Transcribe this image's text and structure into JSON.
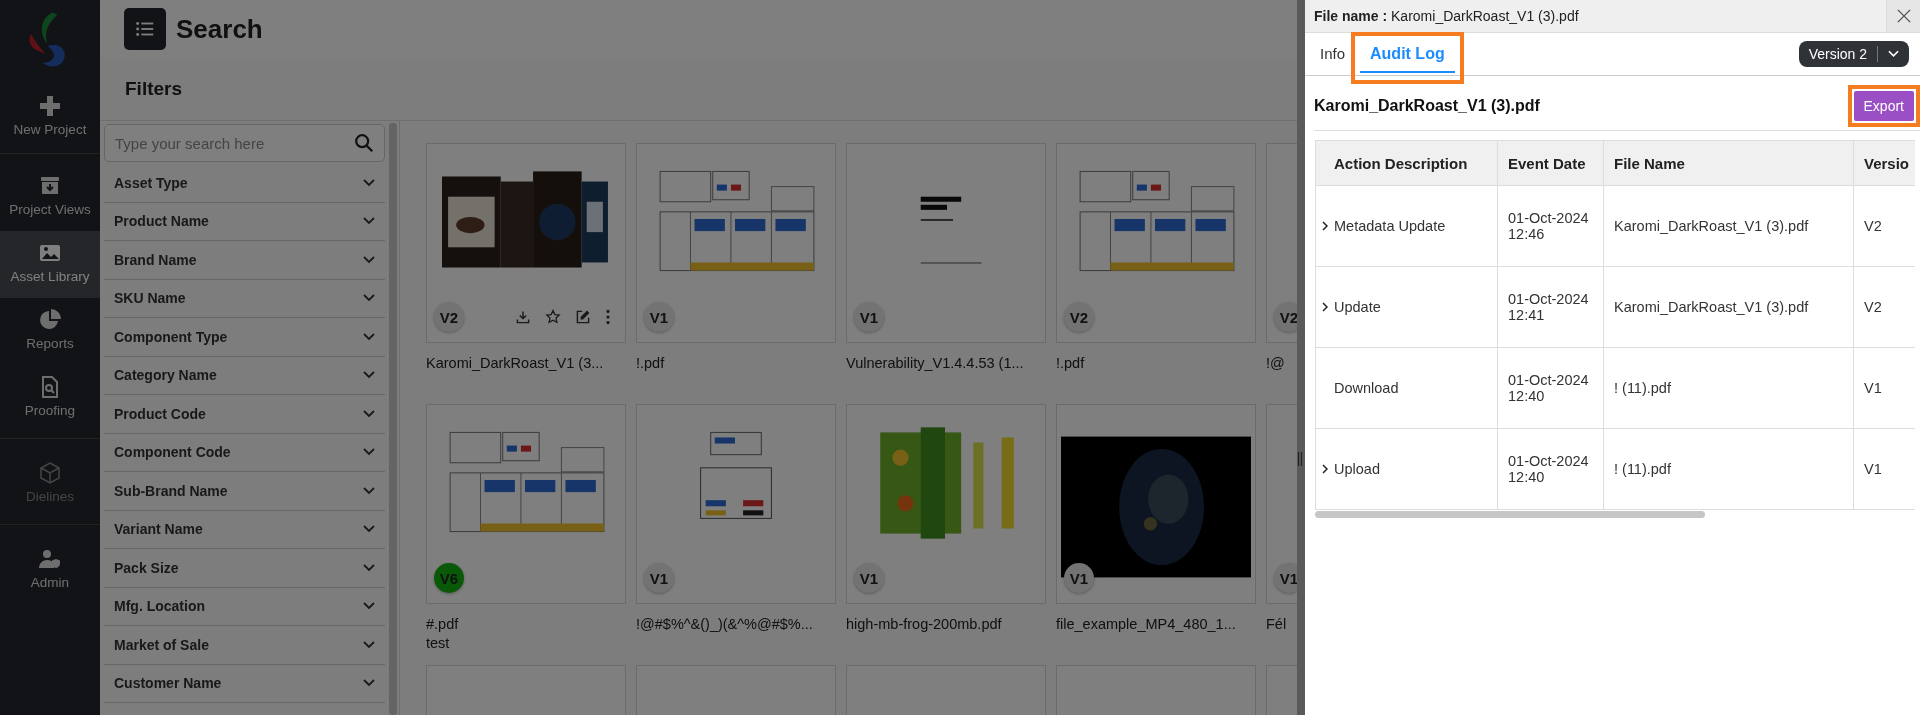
{
  "sidebar": {
    "items": [
      {
        "label": "New Project",
        "selected": false,
        "disabled": false
      },
      {
        "label": "Project Views",
        "selected": false,
        "disabled": false
      },
      {
        "label": "Asset Library",
        "selected": true,
        "disabled": false
      },
      {
        "label": "Reports",
        "selected": false,
        "disabled": false
      },
      {
        "label": "Proofing",
        "selected": false,
        "disabled": false
      },
      {
        "label": "Dielines",
        "selected": false,
        "disabled": true
      },
      {
        "label": "Admin",
        "selected": false,
        "disabled": false
      }
    ]
  },
  "header": {
    "title": "Search"
  },
  "filters": {
    "title": "Filters",
    "search": {
      "placeholder": "Type your search here"
    },
    "items": [
      "Asset Type",
      "Product Name",
      "Brand Name",
      "SKU Name",
      "Component Type",
      "Category Name",
      "Product Code",
      "Component Code",
      "Sub-Brand Name",
      "Variant Name",
      "Pack Size",
      "Mfg. Location",
      "Market of Sale",
      "Customer Name"
    ]
  },
  "assets": [
    {
      "kind": "file",
      "version": "V2",
      "highlighted": false,
      "name": "Karomi_DarkRoast_V1 (3...",
      "hovered": true
    },
    {
      "kind": "file",
      "version": "V1",
      "highlighted": false,
      "name": "!.pdf",
      "hovered": false
    },
    {
      "kind": "file",
      "version": "V1",
      "highlighted": false,
      "name": "Vulnerability_V1.4.4.53 (1...",
      "hovered": false
    },
    {
      "kind": "file",
      "version": "V2",
      "highlighted": false,
      "name": "!.pdf",
      "hovered": false
    },
    {
      "kind": "file",
      "version": "V2",
      "highlighted": false,
      "name": "!@"
    },
    {
      "kind": "file",
      "version": "V6",
      "highlighted": true,
      "name": "#.pdf",
      "note": "test",
      "hovered": false
    },
    {
      "kind": "file",
      "version": "V1",
      "highlighted": false,
      "name": "!@#$%^&()_)(&^%@#$%...",
      "hovered": false
    },
    {
      "kind": "file",
      "version": "V1",
      "highlighted": false,
      "name": "high-mb-frog-200mb.pdf",
      "hovered": false
    },
    {
      "kind": "file",
      "version": "V1",
      "highlighted": false,
      "name": "file_example_MP4_480_1...",
      "hovered": false
    },
    {
      "kind": "file",
      "version": "V1",
      "highlighted": false,
      "name": "Fél"
    },
    {
      "kind": "blank"
    },
    {
      "kind": "blank"
    },
    {
      "kind": "blank"
    },
    {
      "kind": "blank"
    },
    {
      "kind": "blank"
    }
  ],
  "panel": {
    "file_label": "File name :",
    "file_name": "Karomi_DarkRoast_V1 (3).pdf",
    "tabs": [
      {
        "label": "Info",
        "selected": false,
        "highlighted": false
      },
      {
        "label": "Audit Log",
        "selected": true,
        "highlighted": true
      }
    ],
    "version": "Version 2",
    "heading": "Karomi_DarkRoast_V1 (3).pdf",
    "export": {
      "label": "Export",
      "highlighted": true
    },
    "table": {
      "columns": [
        "Action Description",
        "Event Date",
        "File Name",
        "Versio"
      ],
      "rows": [
        {
          "expandable": true,
          "action": "Metadata Update",
          "date": "01-Oct-2024 12:46",
          "file": "Karomi_DarkRoast_V1 (3).pdf",
          "version": "V2"
        },
        {
          "expandable": true,
          "action": "Update",
          "date": "01-Oct-2024 12:41",
          "file": "Karomi_DarkRoast_V1 (3).pdf",
          "version": "V2"
        },
        {
          "expandable": false,
          "action": "Download",
          "date": "01-Oct-2024 12:40",
          "file": "! (11).pdf",
          "version": "V1"
        },
        {
          "expandable": true,
          "action": "Upload",
          "date": "01-Oct-2024 12:40",
          "file": "! (11).pdf",
          "version": "V1"
        }
      ]
    }
  }
}
